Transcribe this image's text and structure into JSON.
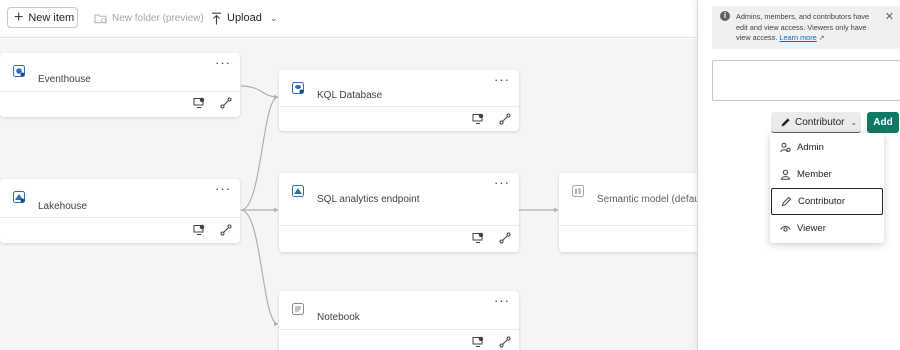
{
  "toolbar": {
    "new_item": "New item",
    "new_folder": "New folder (preview)",
    "upload": "Upload"
  },
  "canvas": {
    "cards": [
      {
        "label": "Eventhouse",
        "icon": "eventhouse-icon"
      },
      {
        "label": "KQL Database",
        "icon": "kql-database-icon"
      },
      {
        "label": "Lakehouse",
        "icon": "lakehouse-icon"
      },
      {
        "label": "SQL analytics endpoint",
        "icon": "sql-endpoint-icon"
      },
      {
        "label": "Semantic model (default)",
        "icon": "semantic-model-icon"
      },
      {
        "label": "Notebook",
        "icon": "notebook-icon"
      }
    ],
    "more_glyph": "···"
  },
  "panel": {
    "info_text": "Admins, members, and contributors have edit and view access. Viewers only have view access.",
    "learn_more": "Learn more",
    "role_selected": "Contributor",
    "add_label": "Add",
    "roles": [
      {
        "label": "Admin",
        "icon": "admin-icon",
        "selected": false
      },
      {
        "label": "Member",
        "icon": "member-icon",
        "selected": false
      },
      {
        "label": "Contributor",
        "icon": "pencil-icon",
        "selected": true
      },
      {
        "label": "Viewer",
        "icon": "eye-icon",
        "selected": false
      }
    ]
  },
  "colors": {
    "accent": "#117865",
    "link": "#0f6cbd",
    "canvas_bg": "#f5f5f5"
  }
}
